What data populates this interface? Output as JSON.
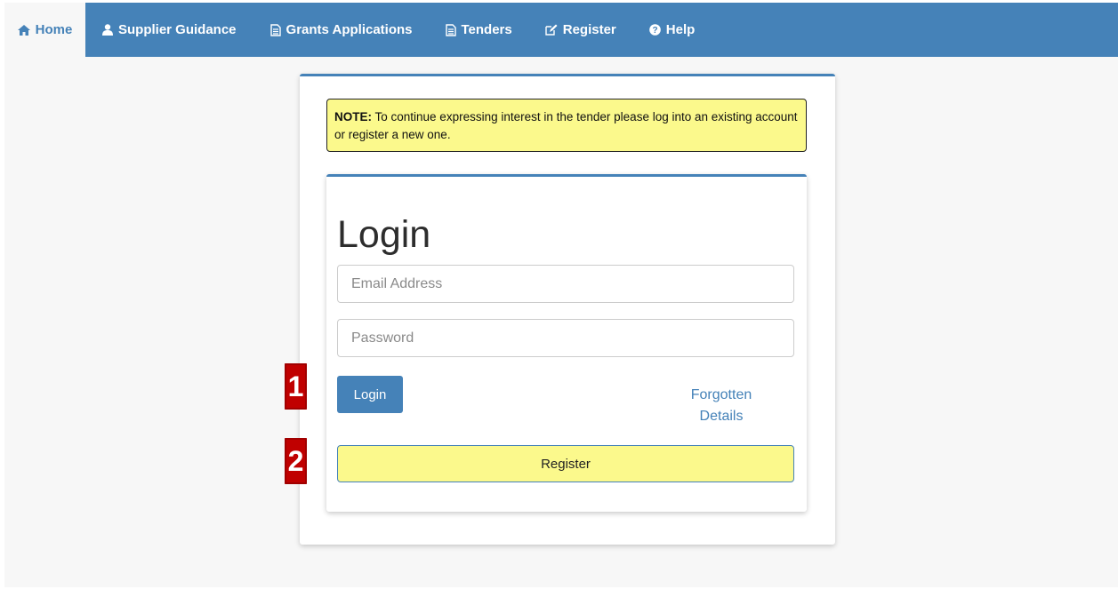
{
  "nav": {
    "items": [
      {
        "label": "Home",
        "icon": "home-icon",
        "active": true
      },
      {
        "label": "Supplier Guidance",
        "icon": "user-icon"
      },
      {
        "label": "Grants Applications",
        "icon": "document-icon"
      },
      {
        "label": "Tenders",
        "icon": "document-icon"
      },
      {
        "label": "Register",
        "icon": "edit-icon"
      },
      {
        "label": "Help",
        "icon": "question-circle-icon"
      }
    ]
  },
  "note": {
    "prefix": "NOTE:",
    "text": " To continue expressing interest in the tender please log into an existing account or register a new one."
  },
  "login": {
    "title": "Login",
    "email_placeholder": "Email Address",
    "password_placeholder": "Password",
    "login_label": "Login",
    "forgot_label_line1": "Forgotten",
    "forgot_label_line2": "Details",
    "register_label": "Register"
  },
  "markers": {
    "step1": "1",
    "step2": "2"
  },
  "colors": {
    "brand": "#4582b8",
    "note_bg": "#fbf98c",
    "marker": "#c00000"
  }
}
